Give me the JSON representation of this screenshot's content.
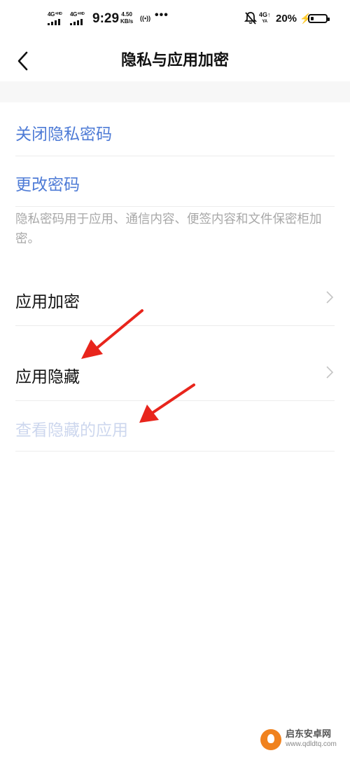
{
  "status_bar": {
    "sim1_network": "4G⁺ᴴᴰ",
    "sim2_network": "4G⁺ᴴᴰ",
    "time": "9:29",
    "speed_value": "4.50",
    "speed_unit": "KB/s",
    "nfc_symbol": "((•))",
    "more_symbol": "•••",
    "data_network": "4G↑",
    "data_sub": "YA",
    "battery_percent": "20%",
    "battery_level_fraction": 0.2
  },
  "nav": {
    "title": "隐私与应用加密"
  },
  "privacy": {
    "close_password": "关闭隐私密码",
    "change_password": "更改密码",
    "description": "隐私密码用于应用、通信内容、便签内容和文件保密柜加密。"
  },
  "apps": {
    "app_encrypt": "应用加密",
    "app_hide": "应用隐藏",
    "view_hidden": "查看隐藏的应用"
  },
  "colors": {
    "link_blue": "#4e7bd6",
    "annotation_red": "#e8251c",
    "watermark_orange": "#f0821e"
  },
  "watermark": {
    "title": "启东安卓网",
    "url": "www.qdldtq.com"
  }
}
